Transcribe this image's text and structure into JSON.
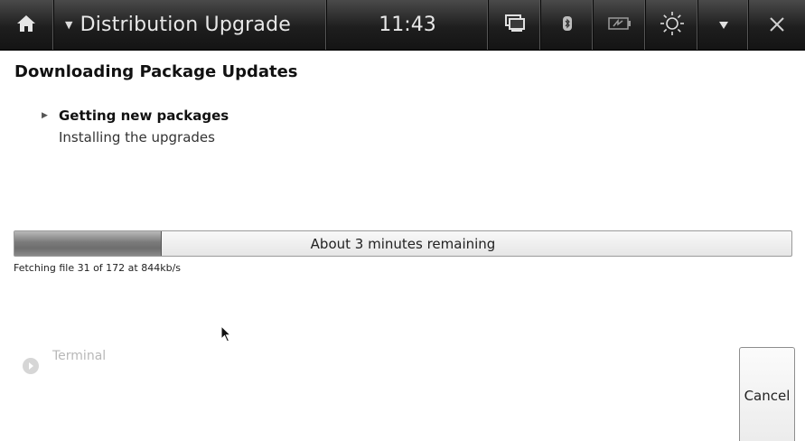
{
  "panel": {
    "title": "Distribution Upgrade",
    "clock": "11:43",
    "icons": [
      "home-icon",
      "network-icon",
      "bluetooth-icon",
      "battery-icon",
      "brightness-icon",
      "dropdown-icon",
      "close-icon"
    ]
  },
  "dialog": {
    "heading": "Downloading Package Updates",
    "steps": [
      {
        "label": "Getting new packages",
        "state": "current"
      },
      {
        "label": "Installing the upgrades",
        "state": "pending"
      }
    ],
    "progress": {
      "fraction": 0.19,
      "text": "About 3 minutes remaining"
    },
    "status": "Fetching file 31 of 172 at 844kb/s",
    "terminal_label": "Terminal",
    "cancel_label": "Cancel"
  },
  "colors": {
    "panel_bg": "#1e1e1e",
    "progress_fill": "#7a7a7a"
  }
}
